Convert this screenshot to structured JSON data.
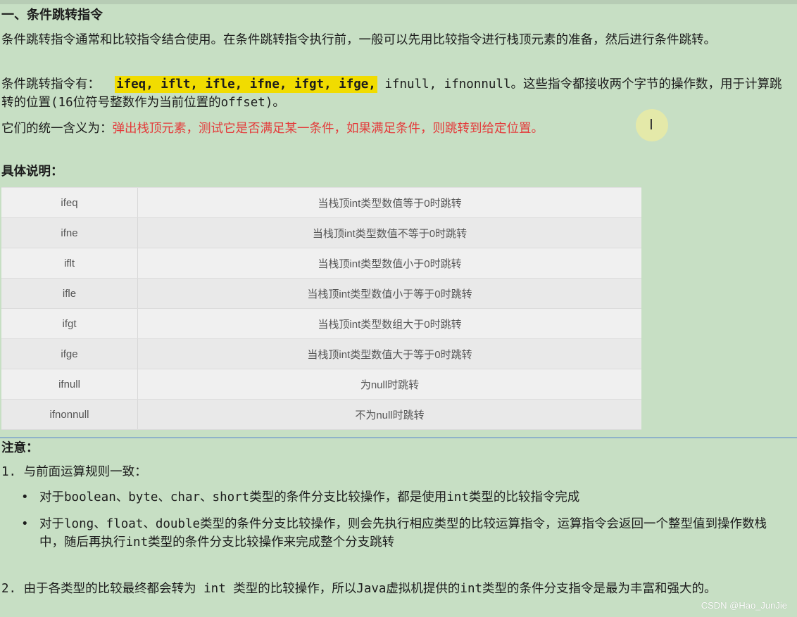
{
  "heading": "一、条件跳转指令",
  "intro": "条件跳转指令通常和比较指令结合使用。在条件跳转指令执行前，一般可以先用比较指令进行栈顶元素的准备，然后进行条件跳转。",
  "list_line": {
    "prefix": "条件跳转指令有：",
    "highlighted": "ifeq, iflt, ifle, ifne, ifgt, ifge,",
    "rest": " ifnull, ifnonnull。这些指令都接收两个字节的操作数，用于计算跳转的位置(16位符号整数作为当前位置的offset)。"
  },
  "meaning": {
    "prefix": "它们的统一含义为：",
    "red": "弹出栈顶元素，测试它是否满足某一条件，如果满足条件，则跳转到给定位置。"
  },
  "detail_heading": "具体说明：",
  "table": [
    {
      "op": "ifeq",
      "desc": "当栈顶int类型数值等于0时跳转"
    },
    {
      "op": "ifne",
      "desc": "当栈顶int类型数值不等于0时跳转"
    },
    {
      "op": "iflt",
      "desc": "当栈顶int类型数值小于0时跳转"
    },
    {
      "op": "ifle",
      "desc": "当栈顶int类型数值小于等于0时跳转"
    },
    {
      "op": "ifgt",
      "desc": "当栈顶int类型数组大于0时跳转"
    },
    {
      "op": "ifge",
      "desc": "当栈顶int类型数值大于等于0时跳转"
    },
    {
      "op": "ifnull",
      "desc": "为null时跳转"
    },
    {
      "op": "ifnonnull",
      "desc": "不为null时跳转"
    }
  ],
  "note_heading": "注意：",
  "note1": "1. 与前面运算规则一致：",
  "bullets": [
    "对于boolean、byte、char、short类型的条件分支比较操作，都是使用int类型的比较指令完成",
    "对于long、float、double类型的条件分支比较操作，则会先执行相应类型的比较运算指令，运算指令会返回一个整型值到操作数栈中，随后再执行int类型的条件分支比较操作来完成整个分支跳转"
  ],
  "bullet_glyph": "•",
  "note2": "2. 由于各类型的比较最终都会转为 int 类型的比较操作，所以Java虚拟机提供的int类型的条件分支指令是最为丰富和强大的。",
  "watermark": "CSDN @Hao_JunJie",
  "cursor_glyph": "I",
  "colors": {
    "background": "#c7dfc4",
    "highlight": "#f1dc00",
    "red_text": "#e43a3a"
  }
}
